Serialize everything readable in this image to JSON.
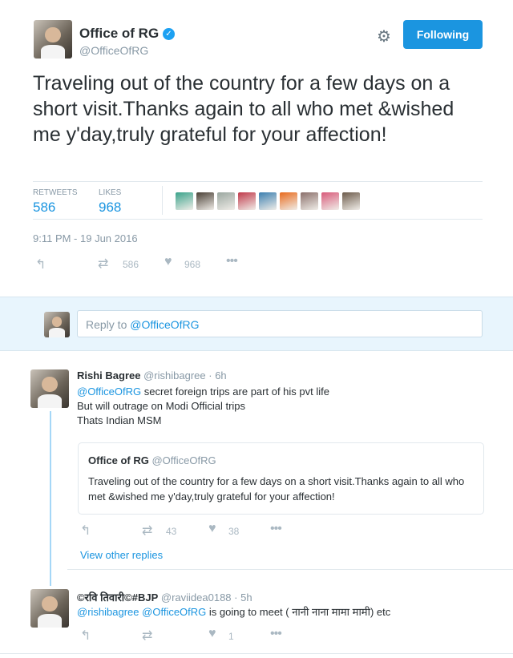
{
  "main_tweet": {
    "author_name": "Office of RG",
    "handle": "@OfficeOfRG",
    "follow_label": "Following",
    "text": "Traveling out of the country for a few days on a short visit.Thanks again to all who met &wished me y'day,truly grateful for your affection!",
    "stats": {
      "retweets_label": "RETWEETS",
      "retweets_value": "586",
      "likes_label": "LIKES",
      "likes_value": "968"
    },
    "timestamp": "9:11 PM - 19 Jun 2016",
    "actions": {
      "retweet_count": "586",
      "like_count": "968"
    },
    "liker_colors": [
      "#3aa38b",
      "#4a4036",
      "#9aa7a0",
      "#c0394a",
      "#3b7fb0",
      "#e86a1c",
      "#8a6f6a",
      "#d85a7a",
      "#6b5a4a"
    ]
  },
  "reply_box": {
    "placeholder": "Reply to @OfficeOfRG"
  },
  "reply1": {
    "author_name": "Rishi Bagree",
    "handle": "@rishibagree",
    "time": "· 6h",
    "mention": "@OfficeOfRG",
    "line1_rest": " secret foreign trips are part of his pvt life",
    "line2": "But will outrage on Modi Official trips",
    "line3": "Thats Indian MSM",
    "quote": {
      "author_name": "Office of RG",
      "handle": "@OfficeOfRG",
      "text": "Traveling out of the country for a few days on a short visit.Thanks again to all who met &wished me y'day,truly grateful for your affection!"
    },
    "retweet_count": "43",
    "like_count": "38",
    "view_replies": "View other replies"
  },
  "reply2": {
    "author_name": "©रवि तिवारी©#BJP",
    "handle": "@raviidea0188",
    "time": "· 5h",
    "mention1": "@rishibagree",
    "mention2": "@OfficeOfRG",
    "text_rest": " is going to meet ( नानी नाना मामा मामी) etc",
    "like_count": "1"
  },
  "icons": {
    "gear": "gear-icon",
    "reply": "reply-icon",
    "retweet": "retweet-icon",
    "like": "heart-icon",
    "more": "more-icon"
  }
}
